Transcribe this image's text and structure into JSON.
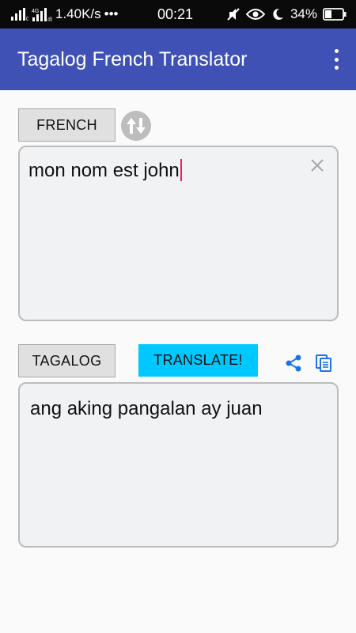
{
  "status_bar": {
    "network_speed": "1.40K/s",
    "network_type": "4G",
    "more": "•••",
    "time": "00:21",
    "battery": "34%"
  },
  "app_bar": {
    "title": "Tagalog French Translator"
  },
  "source": {
    "language_label": "FRENCH",
    "text": "mon nom est john"
  },
  "target": {
    "language_label": "TAGALOG",
    "text": "ang aking pangalan ay juan"
  },
  "actions": {
    "translate_label": "TRANSLATE!"
  },
  "colors": {
    "app_bar": "#3f51b5",
    "translate_button": "#00c8ff",
    "cursor": "#e91e63",
    "action_icons": "#1e73e8"
  }
}
